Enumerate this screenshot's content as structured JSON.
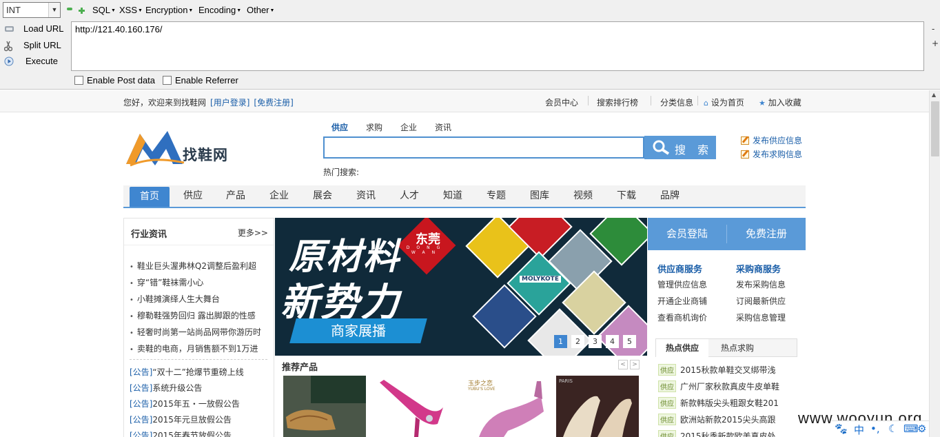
{
  "hackbar": {
    "select_value": "INT",
    "menus": [
      "SQL",
      "XSS",
      "Encryption",
      "Encoding",
      "Other"
    ],
    "load_url": "Load URL",
    "split_url": "Split URL",
    "execute": "Execute",
    "url": "http://121.40.160.176/",
    "side_minus": "-",
    "side_plus": "+",
    "enable_post": "Enable Post data",
    "enable_referrer": "Enable Referrer"
  },
  "topbar": {
    "welcome": "您好，欢迎来到找鞋网",
    "login": "[用户登录]",
    "register": "[免费注册]",
    "links": [
      "会员中心",
      "搜索排行榜",
      "分类信息",
      "设为首页",
      "加入收藏"
    ]
  },
  "header": {
    "logo_text": "找鞋网",
    "search_tabs": [
      "供应",
      "求购",
      "企业",
      "资讯"
    ],
    "search_button": "搜 索",
    "hot_label": "热门搜索:",
    "publish_supply": "发布供应信息",
    "publish_buy": "发布求购信息"
  },
  "nav": [
    "首页",
    "供应",
    "产品",
    "企业",
    "展会",
    "资讯",
    "人才",
    "知道",
    "专题",
    "图库",
    "视频",
    "下载",
    "品牌"
  ],
  "news": {
    "title": "行业资讯",
    "more": "更多>>",
    "items": [
      "鞋业巨头渥弗林Q2调整后盈利超",
      "穿“错”鞋袜需小心",
      "小鞋摊演绎人生大舞台",
      "穆勒鞋强势回归 露出脚跟的性感",
      "轻奢时尚第一站尚品网带你游历时",
      "卖鞋的电商，月销售额不到1万进"
    ],
    "notice_tag": "[公告]",
    "notices": [
      "“双十二”抢爆节重磅上线",
      "系统升级公告",
      "2015年五・一放假公告",
      "2015年元旦放假公告",
      "2015年春节放假公告"
    ]
  },
  "banner": {
    "line1": "原材料",
    "line2": "新势力",
    "seal": "东莞",
    "seal_pinyin": "DONG WAN",
    "showcase": "商家展播",
    "label": "MOLYKOTE",
    "pages": [
      "1",
      "2",
      "3",
      "4",
      "5"
    ],
    "active_page": 1
  },
  "recommend": {
    "title": "推荐产品",
    "prev": "<",
    "next": ">",
    "brand_cn": "玉步之恋",
    "brand_en": "YUBU'S LOVE",
    "brand_paris": "PARIS"
  },
  "member": {
    "login": "会员登陆",
    "register": "免费注册",
    "supplier_title": "供应商服务",
    "buyer_title": "采购商服务",
    "supplier_items": [
      "管理供应信息",
      "开通企业商铺",
      "查看商机询价"
    ],
    "buyer_items": [
      "发布采购信息",
      "订阅最新供应",
      "采购信息管理"
    ]
  },
  "hot_supply": {
    "tabs": [
      "热点供应",
      "热点求购"
    ],
    "badge": "供应",
    "items": [
      "2015秋款单鞋交叉绑带浅",
      "广州厂家秋款真皮牛皮单鞋",
      "新款韩版尖头粗跟女鞋201",
      "欧洲站新款2015尖头高跟",
      "2015秋季新款欧美真皮处"
    ]
  },
  "watermark": "www.wooyun.org",
  "tray": {
    "ime": "中"
  },
  "colors": {
    "accent": "#3f86d0",
    "search_btn": "#5a9ad8",
    "link": "#1a5ea8",
    "seal": "#c8161e"
  }
}
